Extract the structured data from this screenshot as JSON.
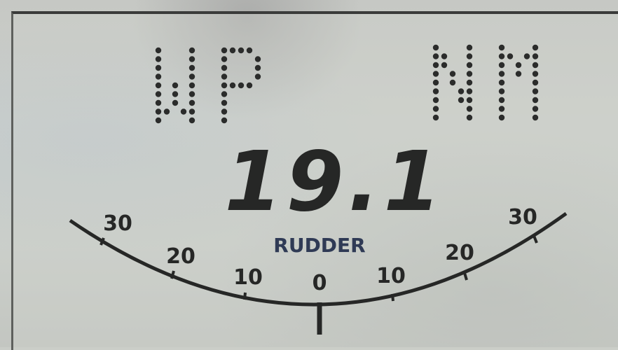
{
  "display": {
    "left_label": "WP",
    "right_label": "NM",
    "value": "19.1"
  },
  "rudder_gauge": {
    "title": "RUDDER",
    "port_ticks": [
      "30",
      "20",
      "10"
    ],
    "center_tick": "0",
    "starboard_ticks": [
      "10",
      "20",
      "30"
    ],
    "rudder_angle_deg": 0
  },
  "colors": {
    "segment": "#262726",
    "background": "#c9ccc7"
  }
}
